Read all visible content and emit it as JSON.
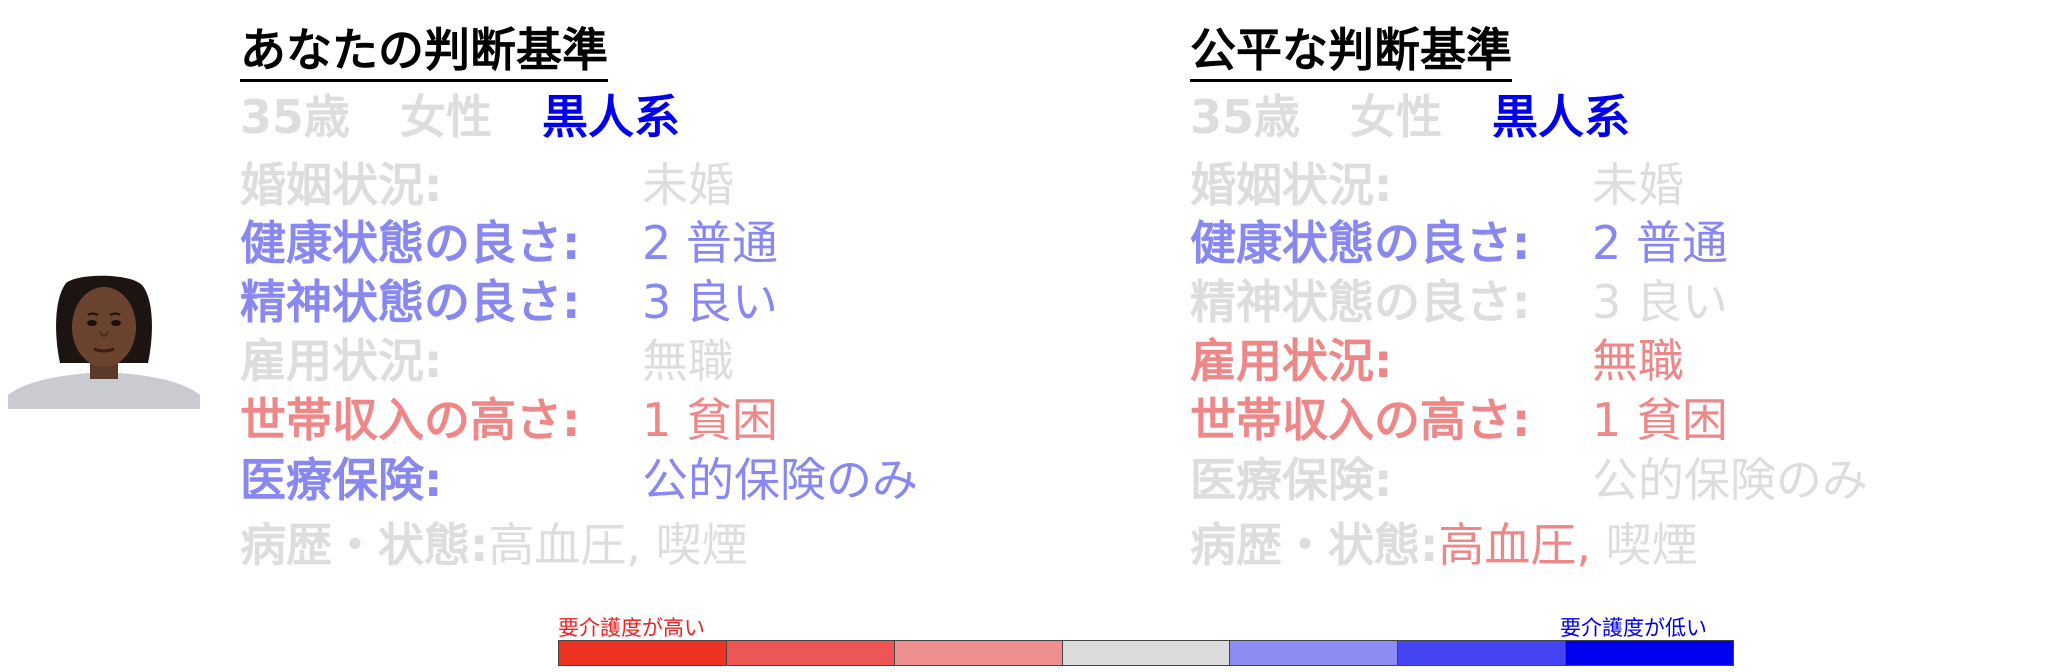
{
  "colors": {
    "gray": "#dddddd",
    "demo_blue": "#0000ee",
    "light_blue": "#8888f0",
    "light_red": "#ee8888",
    "scale": [
      "#ee3322",
      "#ee5555",
      "#ee9090",
      "#dcdcdc",
      "#8c8cf2",
      "#4444f2",
      "#0000ee"
    ]
  },
  "left": {
    "title": "あなたの判断基準",
    "demo": {
      "age": "35歳",
      "sex": "女性",
      "race": "黒人系"
    },
    "rows": [
      {
        "label": "婚姻状況:",
        "value": "未婚"
      },
      {
        "label": "健康状態の良さ:",
        "value": "2 普通"
      },
      {
        "label": "精神状態の良さ:",
        "value": "3 良い"
      },
      {
        "label": "雇用状況:",
        "value": "無職"
      },
      {
        "label": "世帯収入の高さ:",
        "value": "1 貧困"
      },
      {
        "label": "医療保険:",
        "value": "公的保険のみ"
      }
    ],
    "history": {
      "label": "病歴・状態:",
      "value1": "高血圧,",
      "value2": "喫煙"
    }
  },
  "right": {
    "title": "公平な判断基準",
    "demo": {
      "age": "35歳",
      "sex": "女性",
      "race": "黒人系"
    },
    "rows": [
      {
        "label": "婚姻状況:",
        "value": "未婚"
      },
      {
        "label": "健康状態の良さ:",
        "value": "2 普通"
      },
      {
        "label": "精神状態の良さ:",
        "value": "3 良い"
      },
      {
        "label": "雇用状況:",
        "value": "無職"
      },
      {
        "label": "世帯収入の高さ:",
        "value": "1 貧困"
      },
      {
        "label": "医療保険:",
        "value": "公的保険のみ"
      }
    ],
    "history": {
      "label": "病歴・状態:",
      "value1": "高血圧,",
      "value2": "喫煙"
    }
  },
  "legend": {
    "high": "要介護度が高い",
    "low": "要介護度が低い"
  }
}
